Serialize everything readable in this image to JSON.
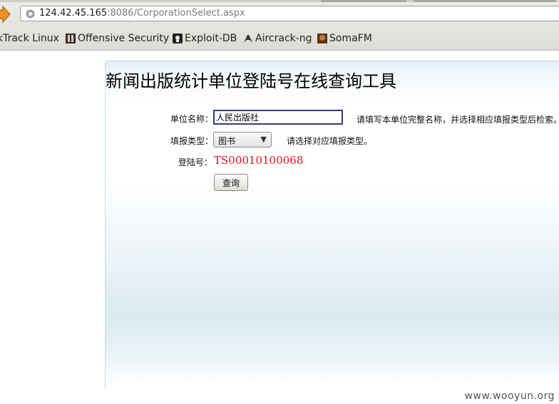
{
  "browser": {
    "url_host": "124.42.45.165",
    "url_rest": ":8086/CorporationSelect.aspx",
    "bookmarks": [
      {
        "label": "kTrack Linux",
        "icon": "none"
      },
      {
        "label": "Offensive Security",
        "icon": "offensive-security-icon"
      },
      {
        "label": "Exploit-DB",
        "icon": "exploit-db-icon"
      },
      {
        "label": "Aircrack-ng",
        "icon": "aircrack-icon"
      },
      {
        "label": "SomaFM",
        "icon": "somafm-icon"
      }
    ]
  },
  "page": {
    "title": "新闻出版统计单位登陆号在线查询工具",
    "name_label": "单位名称：",
    "name_value": "人民出版社",
    "name_hint": "请填写本单位完整名称，并选择相应填报类型后检索。",
    "type_label": "填报类型：",
    "type_value": "图书",
    "type_hint": "请选择对应填报类型。",
    "login_label": "登陆号：",
    "login_value": "TS00010100068",
    "query_label": "查询"
  },
  "watermark": "www.wooyun.org",
  "colors": {
    "login_value": "#e0101a",
    "input_border": "#2b3d80"
  }
}
